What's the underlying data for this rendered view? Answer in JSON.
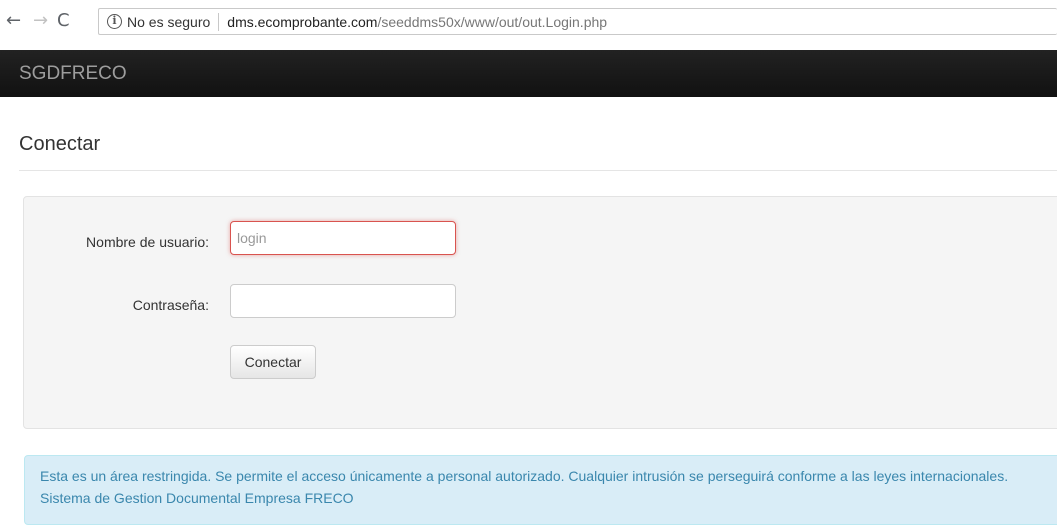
{
  "browser": {
    "back_glyph": "←",
    "forward_glyph": "→",
    "reload_glyph": "C",
    "info_glyph": "i",
    "security_text": "No es seguro",
    "url_host": "dms.ecomprobante.com",
    "url_path": "/seeddms50x/www/out/out.Login.php"
  },
  "navbar": {
    "brand": "SGDFRECO"
  },
  "page": {
    "title": "Conectar"
  },
  "form": {
    "username_label": "Nombre de usuario:",
    "username_placeholder": "login",
    "username_value": "",
    "password_label": "Contraseña:",
    "submit_label": "Conectar"
  },
  "alert": {
    "line1": "Esta es un área restringida. Se permite el acceso únicamente a personal autorizado. Cualquier intrusión se perseguirá conforme a las leyes internacionales.",
    "line2": "Sistema de Gestion Documental Empresa FRECO"
  },
  "colors": {
    "navbar_bg": "#222222",
    "alert_text": "#3a87ad",
    "alert_bg": "#d9edf7",
    "error_border": "#d9534f"
  }
}
